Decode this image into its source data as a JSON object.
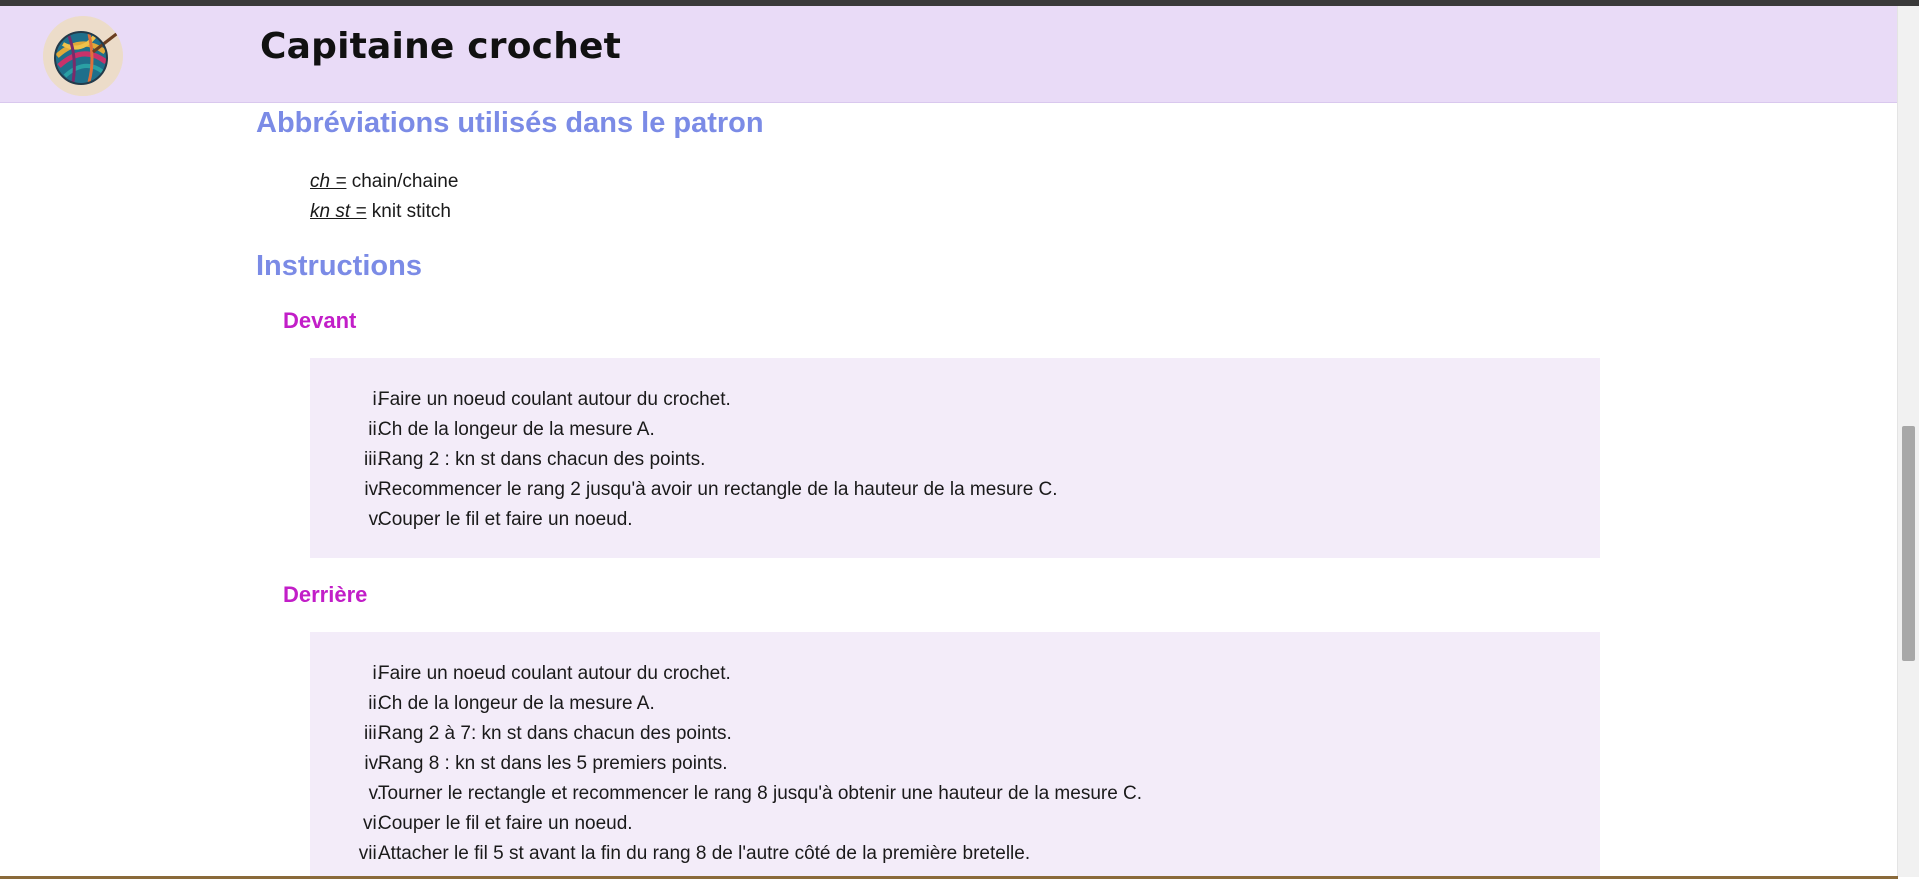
{
  "header": {
    "title": "Capitaine crochet",
    "logo_icon": "yarn-ball-icon",
    "background": "#e9dbf7"
  },
  "abbreviations": {
    "heading": "Abbréviations utilisés dans le patron",
    "items": [
      {
        "term": "ch =",
        "definition": " chain/chaine"
      },
      {
        "term": "kn st =",
        "definition": " knit stitch"
      }
    ]
  },
  "instructions": {
    "heading": "Instructions",
    "sections": [
      {
        "title": "Devant",
        "steps": [
          {
            "num": "i.",
            "text": "Faire un noeud coulant autour du crochet."
          },
          {
            "num": "ii.",
            "text": "Ch de la longeur de la mesure A."
          },
          {
            "num": "iii.",
            "text": "Rang 2 : kn st dans chacun des points."
          },
          {
            "num": "iv.",
            "text": "Recommencer le rang 2 jusqu'à avoir un rectangle de la hauteur de la mesure C."
          },
          {
            "num": "v.",
            "text": "Couper le fil et faire un noeud."
          }
        ]
      },
      {
        "title": "Derrière",
        "steps": [
          {
            "num": "i.",
            "text": "Faire un noeud coulant autour du crochet."
          },
          {
            "num": "ii.",
            "text": "Ch de la longeur de la mesure A."
          },
          {
            "num": "iii.",
            "text": "Rang 2 à 7: kn st dans chacun des points."
          },
          {
            "num": "iv.",
            "text": "Rang 8 : kn st dans les 5 premiers points."
          },
          {
            "num": "v.",
            "text": "Tourner le rectangle et recommencer le rang 8 jusqu'à obtenir une hauteur de la mesure C."
          },
          {
            "num": "vi.",
            "text": "Couper le fil et faire un noeud."
          },
          {
            "num": "vii.",
            "text": "Attacher le fil 5 st avant la fin du rang 8 de l'autre côté de la première bretelle."
          }
        ]
      }
    ]
  },
  "colors": {
    "h2": "#7b8be6",
    "h3": "#c21ec8",
    "box": "#f3ecf9"
  }
}
